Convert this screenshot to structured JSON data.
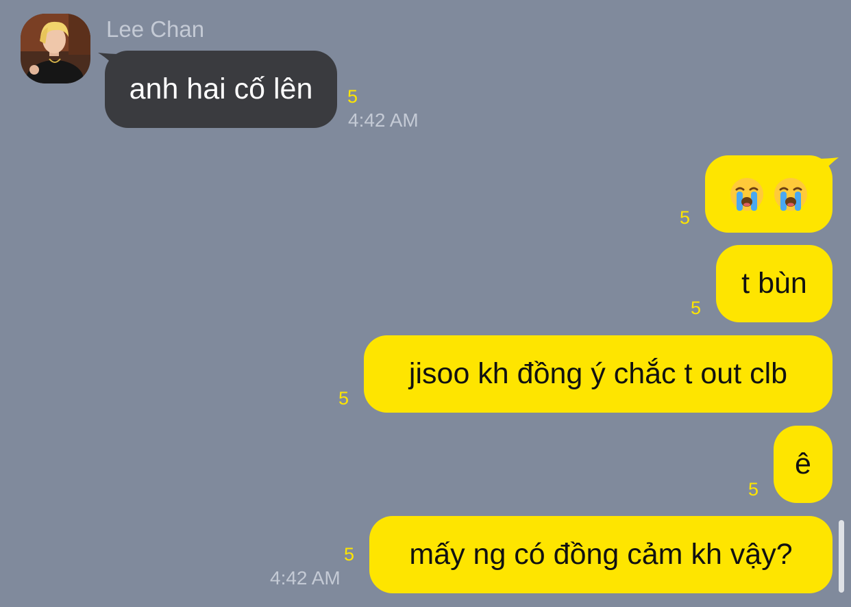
{
  "contact": {
    "name": "Lee Chan",
    "avatar_icon": "profile-photo-avatar"
  },
  "messages": [
    {
      "id": "m1",
      "direction": "incoming",
      "text": "anh hai cố lên",
      "unread_count": "5",
      "time": "4:42 AM"
    },
    {
      "id": "m2",
      "direction": "outgoing",
      "text": "😭😭",
      "emoji_icons": [
        "loudly-crying-face-icon",
        "loudly-crying-face-icon"
      ],
      "unread_count": "5"
    },
    {
      "id": "m3",
      "direction": "outgoing",
      "text": "t bùn",
      "unread_count": "5"
    },
    {
      "id": "m4",
      "direction": "outgoing",
      "text": "jisoo kh đồng ý chắc t out clb",
      "unread_count": "5"
    },
    {
      "id": "m5",
      "direction": "outgoing",
      "text": "ê",
      "unread_count": "5"
    },
    {
      "id": "m6",
      "direction": "outgoing",
      "text": "mấy ng có đồng cảm kh vậy?",
      "unread_count": "5",
      "time": "4:42 AM"
    }
  ],
  "colors": {
    "background": "#808a9c",
    "incoming_bubble": "#3a3b3f",
    "outgoing_bubble": "#fee500",
    "unread_count": "#fee500",
    "meta_text": "#c4cad5"
  }
}
